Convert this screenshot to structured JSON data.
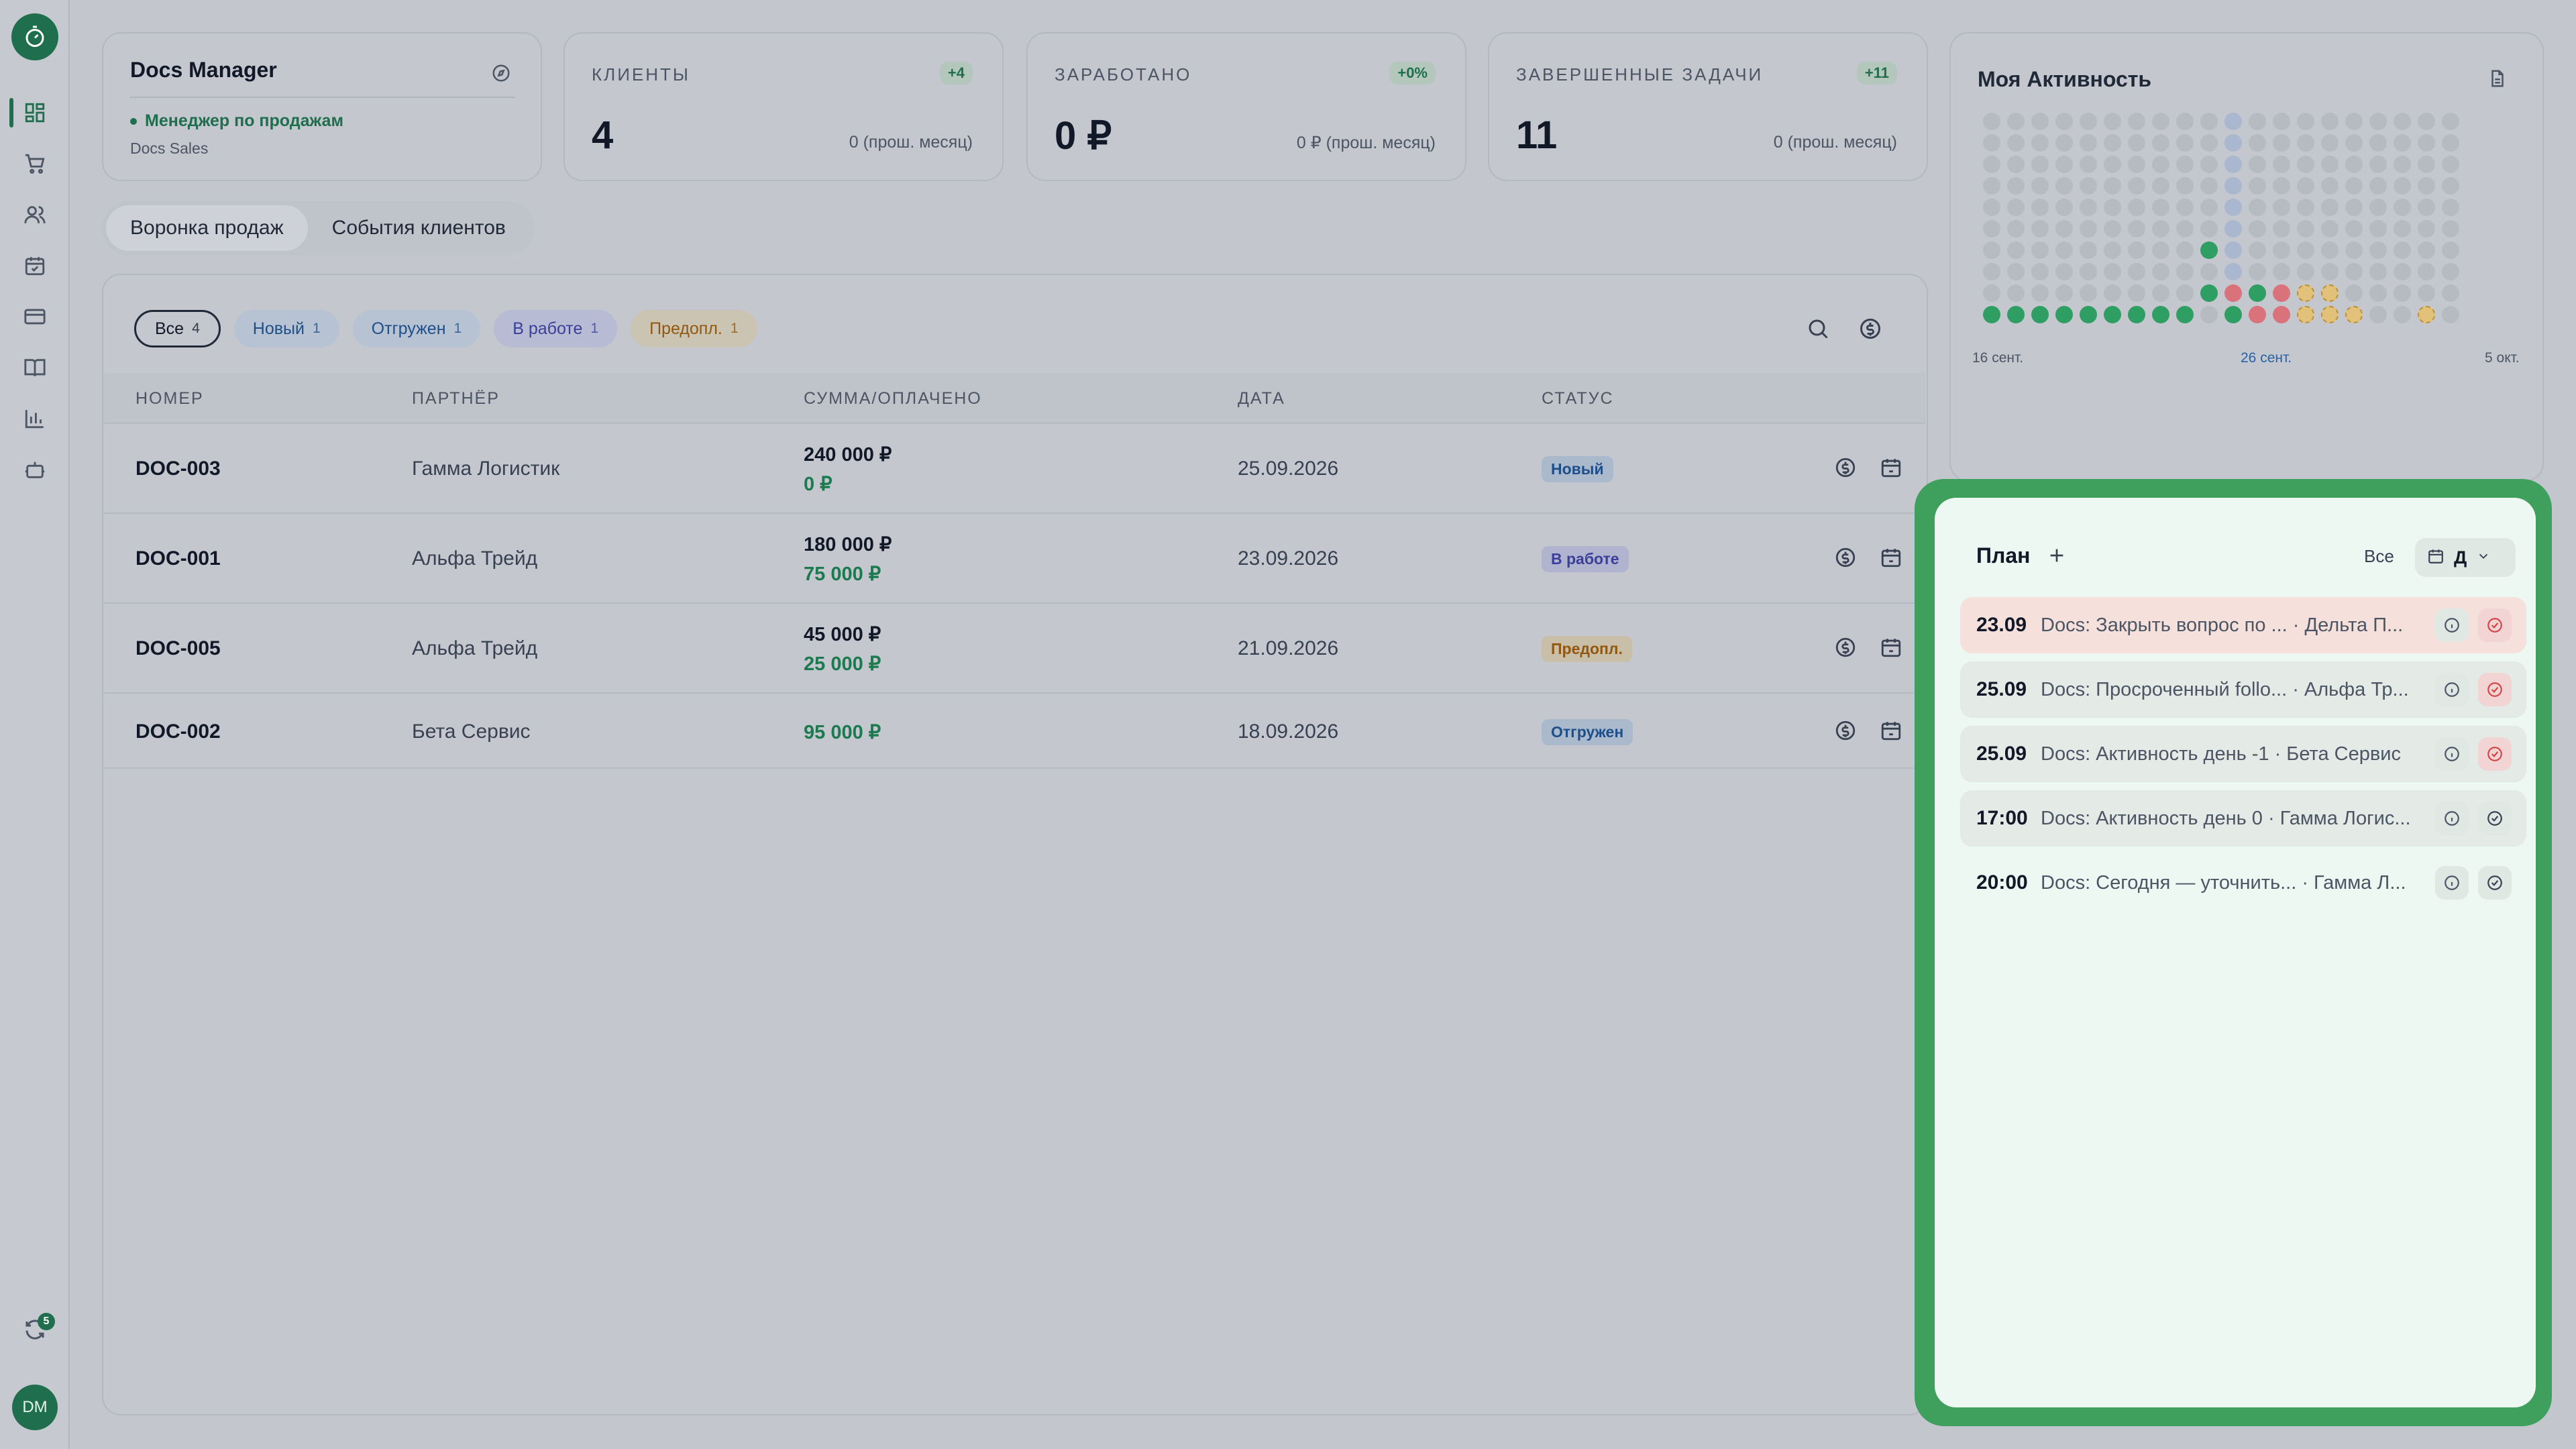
{
  "app": {
    "title": "Docs Manager"
  },
  "profile": {
    "title": "Docs Manager",
    "role": "Менеджер по продажам",
    "team": "Docs Sales"
  },
  "kpis": [
    {
      "label": "КЛИЕНТЫ",
      "delta": "+4",
      "value": "4",
      "prev": "0 (прош. месяц)"
    },
    {
      "label": "ЗАРАБОТАНО",
      "delta": "+0%",
      "value": "0 ₽",
      "prev": "0 ₽ (прош. месяц)"
    },
    {
      "label": "ЗАВЕРШЕННЫЕ ЗАДАЧИ",
      "delta": "+11",
      "value": "11",
      "prev": "0 (прош. месяц)"
    }
  ],
  "tabs": [
    "Воронка продаж",
    "События клиентов"
  ],
  "filters": [
    {
      "label": "Все",
      "count": "4"
    },
    {
      "label": "Новый",
      "count": "1"
    },
    {
      "label": "Отгружен",
      "count": "1"
    },
    {
      "label": "В работе",
      "count": "1"
    },
    {
      "label": "Предопл.",
      "count": "1"
    }
  ],
  "table": {
    "headers": [
      "НОМЕР",
      "ПАРТНЁР",
      "СУММА/ОПЛАЧЕНО",
      "ДАТА",
      "СТАТУС"
    ],
    "rows": [
      {
        "num": "DOC-003",
        "partner": "Гамма Логистик",
        "sum": "240 000 ₽",
        "paid": "0 ₽",
        "date": "25.09.2026",
        "status": "Новый"
      },
      {
        "num": "DOC-001",
        "partner": "Альфа Трейд",
        "sum": "180 000 ₽",
        "paid": "75 000 ₽",
        "date": "23.09.2026",
        "status": "В работе"
      },
      {
        "num": "DOC-005",
        "partner": "Альфа Трейд",
        "sum": "45 000 ₽",
        "paid": "25 000 ₽",
        "date": "21.09.2026",
        "status": "Предопл."
      },
      {
        "num": "DOC-002",
        "partner": "Бета Сервис",
        "sum": "",
        "paid": "95 000 ₽",
        "date": "18.09.2026",
        "status": "Отгружен"
      }
    ]
  },
  "activity": {
    "title": "Моя Активность",
    "date_start": "16 сент.",
    "date_mid": "26 сент.",
    "date_end": "5 окт."
  },
  "plan": {
    "title": "План",
    "filter_all": "Все",
    "view": "Д",
    "items": [
      {
        "time": "23.09",
        "text": "Docs: Закрыть вопрос по ... · Дельта П...",
        "overdue": true
      },
      {
        "time": "25.09",
        "text": "Docs: Просроченный follo... · Альфа Тр...",
        "overdue": true
      },
      {
        "time": "25.09",
        "text": "Docs: Активность день -1 · Бета Сервис",
        "overdue": true
      },
      {
        "time": "17:00",
        "text": "Docs: Активность день 0 · Гамма Логис...",
        "overdue": false
      },
      {
        "time": "20:00",
        "text": "Docs: Сегодня — уточнить... · Гамма Л...",
        "overdue": false
      }
    ]
  },
  "sync": {
    "badge": "5"
  },
  "user": {
    "initials": "DM"
  },
  "colors": {
    "accent": "#1f6e4d",
    "plan_highlight": "#3fa05d",
    "paid": "#1c7a4f"
  }
}
